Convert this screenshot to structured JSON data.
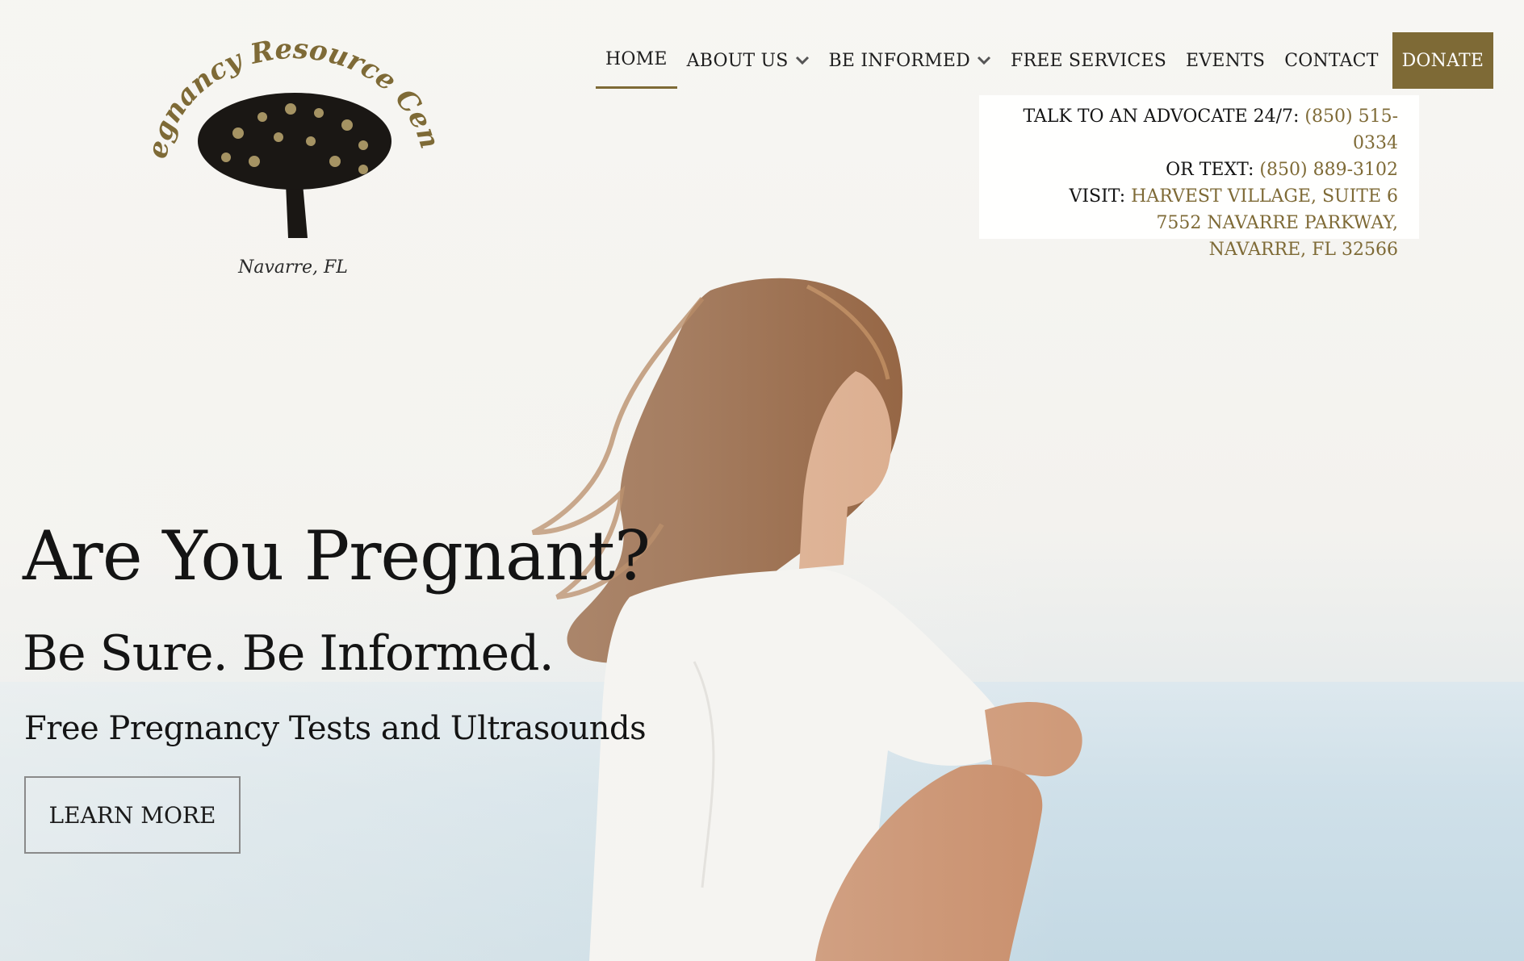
{
  "brand": {
    "logo_arc_text": "Pregnancy Resource Center",
    "logo_location": "Navarre, FL",
    "accent_color": "#7e6a36"
  },
  "nav": {
    "items": [
      {
        "label": "HOME",
        "active": true
      },
      {
        "label": "ABOUT US",
        "dropdown": true
      },
      {
        "label": "BE INFORMED",
        "dropdown": true
      },
      {
        "label": "FREE SERVICES"
      },
      {
        "label": "EVENTS"
      },
      {
        "label": "CONTACT"
      }
    ],
    "donate_label": "DONATE"
  },
  "contact": {
    "advocate_label": "TALK TO AN ADVOCATE 24/7:",
    "advocate_phone": "(850) 515-0334",
    "text_label": "OR TEXT:",
    "text_phone": "(850) 889-3102",
    "visit_label": "VISIT:",
    "address_line1": "HARVEST VILLAGE, SUITE 6",
    "address_line2": "7552 NAVARRE PARKWAY,",
    "address_line3": "NAVARRE, FL 32566"
  },
  "hero": {
    "headline": "Are You Pregnant?",
    "subhead": "Be Sure. Be Informed.",
    "tagline": "Free Pregnancy Tests and Ultrasounds",
    "cta_label": "LEARN MORE"
  }
}
